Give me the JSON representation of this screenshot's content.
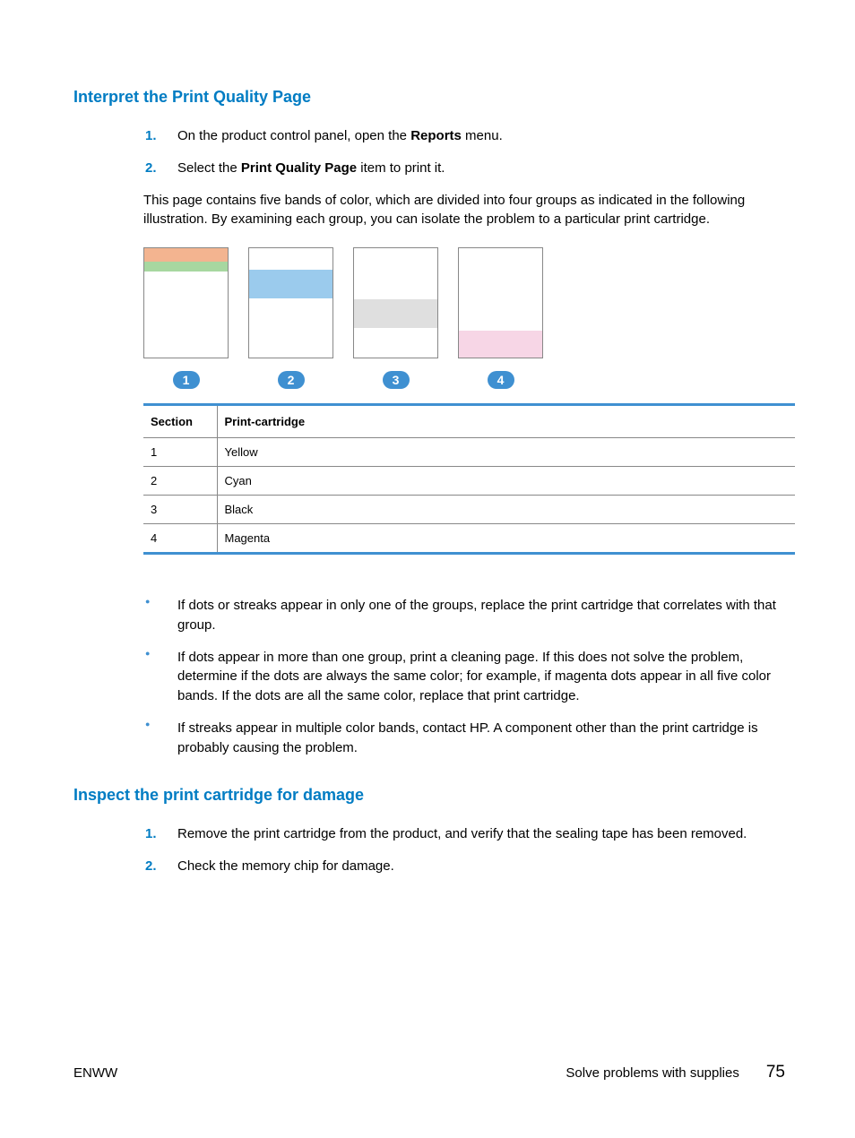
{
  "heading1": "Interpret the Print Quality Page",
  "steps1": [
    {
      "num": "1.",
      "pre": "On the product control panel, open the ",
      "bold": "Reports",
      "post": " menu."
    },
    {
      "num": "2.",
      "pre": "Select the ",
      "bold": "Print Quality Page",
      "post": " item to print it."
    }
  ],
  "para1": "This page contains five bands of color, which are divided into four groups as indicated in the following illustration. By examining each group, you can isolate the problem to a particular print cartridge.",
  "badges": [
    "1",
    "2",
    "3",
    "4"
  ],
  "table": {
    "headers": [
      "Section",
      "Print-cartridge"
    ],
    "rows": [
      [
        "1",
        "Yellow"
      ],
      [
        "2",
        "Cyan"
      ],
      [
        "3",
        "Black"
      ],
      [
        "4",
        "Magenta"
      ]
    ]
  },
  "bullets": [
    "If dots or streaks appear in only one of the groups, replace the print cartridge that correlates with that group.",
    "If dots appear in more than one group, print a cleaning page. If this does not solve the problem, determine if the dots are always the same color; for example, if magenta dots appear in all five color bands. If the dots are all the same color, replace that print cartridge.",
    "If streaks appear in multiple color bands, contact HP. A component other than the print cartridge is probably causing the problem."
  ],
  "heading2": "Inspect the print cartridge for damage",
  "steps2": [
    {
      "num": "1.",
      "text": "Remove the print cartridge from the product, and verify that the sealing tape has been removed."
    },
    {
      "num": "2.",
      "text": "Check the memory chip for damage."
    }
  ],
  "footer": {
    "left": "ENWW",
    "right_text": "Solve problems with supplies",
    "page": "75"
  },
  "colors": {
    "orange": "#f3b490",
    "green": "#a7d7a0",
    "cyan": "#9bcbed",
    "grey": "#dfdfdf",
    "pink": "#f7d6e6"
  }
}
